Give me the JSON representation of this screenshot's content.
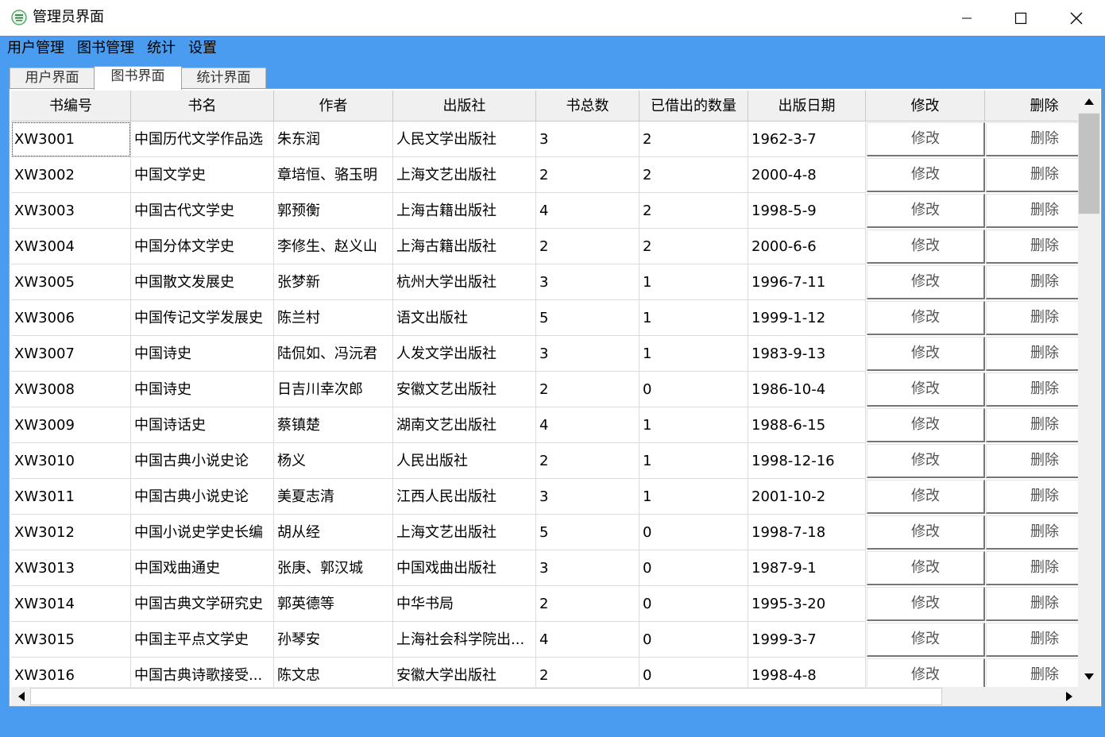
{
  "window": {
    "title": "管理员界面",
    "icon": "library-app-icon",
    "controls": [
      "minimize-icon",
      "maximize-icon",
      "close-icon"
    ]
  },
  "menu": [
    "用户管理",
    "图书管理",
    "统计",
    "设置"
  ],
  "tabs": [
    "用户界面",
    "图书界面",
    "统计界面"
  ],
  "active_tab": "图书界面",
  "table": {
    "columns": [
      "书编号",
      "书名",
      "作者",
      "出版社",
      "书总数",
      "已借出的数量",
      "出版日期",
      "修改",
      "删除"
    ],
    "edit_label": "修改",
    "delete_label": "删除",
    "rows": [
      [
        "XW3001",
        "中国历代文学作品选",
        "朱东润",
        "人民文学出版社",
        "3",
        "2",
        "1962-3-7"
      ],
      [
        "XW3002",
        "中国文学史",
        "章培恒、骆玉明",
        "上海文艺出版社",
        "2",
        "2",
        "2000-4-8"
      ],
      [
        "XW3003",
        "中国古代文学史",
        "郭预衡",
        "上海古籍出版社",
        "4",
        "2",
        "1998-5-9"
      ],
      [
        "XW3004",
        "中国分体文学史",
        "李修生、赵义山",
        "上海古籍出版社",
        "2",
        "2",
        "2000-6-6"
      ],
      [
        "XW3005",
        "中国散文发展史",
        "张梦新",
        "杭州大学出版社",
        "3",
        "1",
        "1996-7-11"
      ],
      [
        "XW3006",
        "中国传记文学发展史",
        "陈兰村",
        "语文出版社",
        "5",
        "1",
        "1999-1-12"
      ],
      [
        "XW3007",
        "中国诗史",
        "陆侃如、冯沅君",
        "人发文学出版社",
        "3",
        "1",
        "1983-9-13"
      ],
      [
        "XW3008",
        "中国诗史",
        "日吉川幸次郎",
        "安徽文艺出版社",
        "2",
        "0",
        "1986-10-4"
      ],
      [
        "XW3009",
        "中国诗话史",
        "蔡镇楚",
        "湖南文艺出版社",
        "4",
        "1",
        "1988-6-15"
      ],
      [
        "XW3010",
        "中国古典小说史论",
        "杨义",
        "人民出版社",
        "2",
        "1",
        "1998-12-16"
      ],
      [
        "XW3011",
        "中国古典小说史论",
        "美夏志清",
        "江西人民出版社",
        "3",
        "1",
        "2001-10-2"
      ],
      [
        "XW3012",
        "中国小说史学史长编",
        "胡从经",
        "上海文艺出版社",
        "5",
        "0",
        "1998-7-18"
      ],
      [
        "XW3013",
        "中国戏曲通史",
        "张庚、郭汉城",
        "中国戏曲出版社",
        "3",
        "0",
        "1987-9-1"
      ],
      [
        "XW3014",
        "中国古典文学研究史",
        "郭英德等",
        "中华书局",
        "2",
        "0",
        "1995-3-20"
      ],
      [
        "XW3015",
        "中国主平点文学史",
        "孙琴安",
        "上海社会科学院出...",
        "4",
        "0",
        "1999-3-7"
      ],
      [
        "XW3016",
        "中国古典诗歌接受...",
        "陈文忠",
        "安徽大学出版社",
        "2",
        "0",
        "1998-4-8"
      ]
    ]
  },
  "colors": {
    "accent": "#4a9cf0",
    "header_bg": "#f0f0f0",
    "grid_line": "#dcdcdc"
  }
}
